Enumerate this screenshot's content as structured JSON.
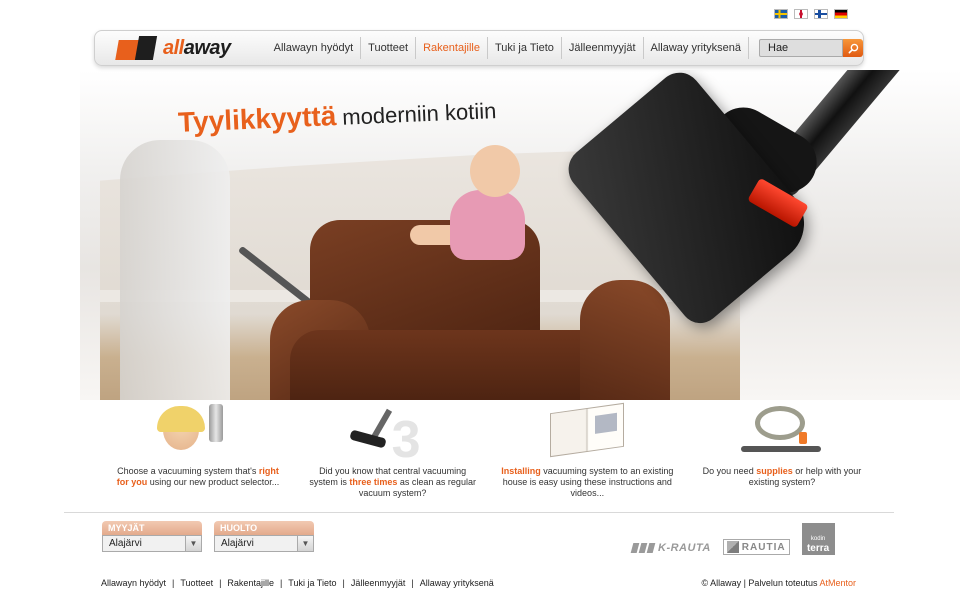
{
  "languages": [
    {
      "code": "sv",
      "icon": "sweden-flag-icon"
    },
    {
      "code": "en",
      "icon": "uk-flag-icon"
    },
    {
      "code": "fi",
      "icon": "finland-flag-icon"
    },
    {
      "code": "de",
      "icon": "germany-flag-icon"
    }
  ],
  "brand": {
    "prefix": "all",
    "suffix": "away",
    "accent": "#e8601c"
  },
  "nav": {
    "items": [
      {
        "label": "Allawayn hyödyt",
        "active": false
      },
      {
        "label": "Tuotteet",
        "active": false
      },
      {
        "label": "Rakentajille",
        "active": true
      },
      {
        "label": "Tuki ja Tieto",
        "active": false
      },
      {
        "label": "Jälleenmyyjät",
        "active": false
      },
      {
        "label": "Allaway yrityksenä",
        "active": false
      }
    ],
    "search_placeholder": "Hae",
    "search_icon": "search-icon"
  },
  "hero": {
    "headline_orange": "Tyylikkyyttä",
    "headline_dark": "moderniin kotiin"
  },
  "features": [
    {
      "pre": "Choose a vacuuming system that's ",
      "hi": "right for you",
      "post": " using our new product selector..."
    },
    {
      "pre": "Did you know that central vacuuming system is ",
      "hi": "three times",
      "post": " as clean as regular vacuum system?"
    },
    {
      "pre": "",
      "hi": "Installing",
      "post": " vacuuming system to an existing house is easy using these instructions and videos..."
    },
    {
      "pre": "Do you need ",
      "hi": "supplies",
      "post": " or help with your existing system?"
    }
  ],
  "selectors": {
    "dealers": {
      "label": "MYYJÄT",
      "value": "Alajärvi"
    },
    "service": {
      "label": "HUOLTO",
      "value": "Alajärvi"
    }
  },
  "partners": {
    "krauta": "K-RAUTA",
    "rautia": "RAUTIA",
    "terra_small": "kodin",
    "terra": "terra"
  },
  "footer": {
    "links": [
      "Allawayn hyödyt",
      "Tuotteet",
      "Rakentajille",
      "Tuki ja Tieto",
      "Jälleenmyyjät",
      "Allaway yrityksenä"
    ],
    "copyright": "© Allaway | Palvelun toteutus ",
    "credit": "AtMentor"
  }
}
